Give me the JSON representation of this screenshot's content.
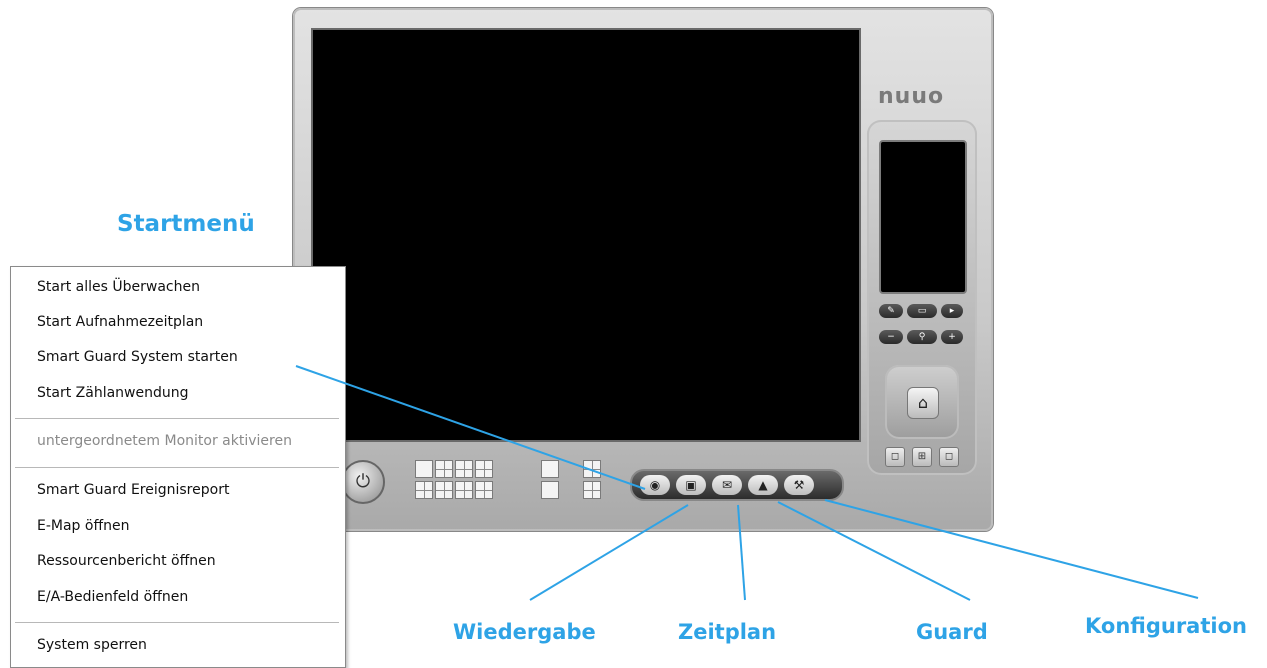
{
  "title": "Startmenü",
  "app": {
    "brand": "nuuo",
    "toolbar_icons": [
      "playback-icon",
      "schedule-icon",
      "guard-icon",
      "warning-icon",
      "config-icon"
    ]
  },
  "menu": {
    "items": [
      {
        "label": "Start alles Überwachen",
        "enabled": true
      },
      {
        "label": "Start Aufnahmezeitplan",
        "enabled": true
      },
      {
        "label": "Smart Guard System starten",
        "enabled": true
      },
      {
        "label": "Start Zählanwendung",
        "enabled": true
      },
      {
        "label": "untergeordnetem Monitor aktivieren",
        "enabled": false
      },
      {
        "label": "Smart Guard Ereignisreport",
        "enabled": true
      },
      {
        "label": "E-Map öffnen",
        "enabled": true
      },
      {
        "label": "Ressourcenbericht öffnen",
        "enabled": true
      },
      {
        "label": "E/A-Bedienfeld öffnen",
        "enabled": true
      },
      {
        "label": "System sperren",
        "enabled": true
      }
    ]
  },
  "callouts": {
    "wiedergabe": "Wiedergabe",
    "zeitplan": "Zeitplan",
    "guard": "Guard",
    "konfiguration": "Konfiguration"
  },
  "colors": {
    "callout": "#2ea3e6"
  }
}
